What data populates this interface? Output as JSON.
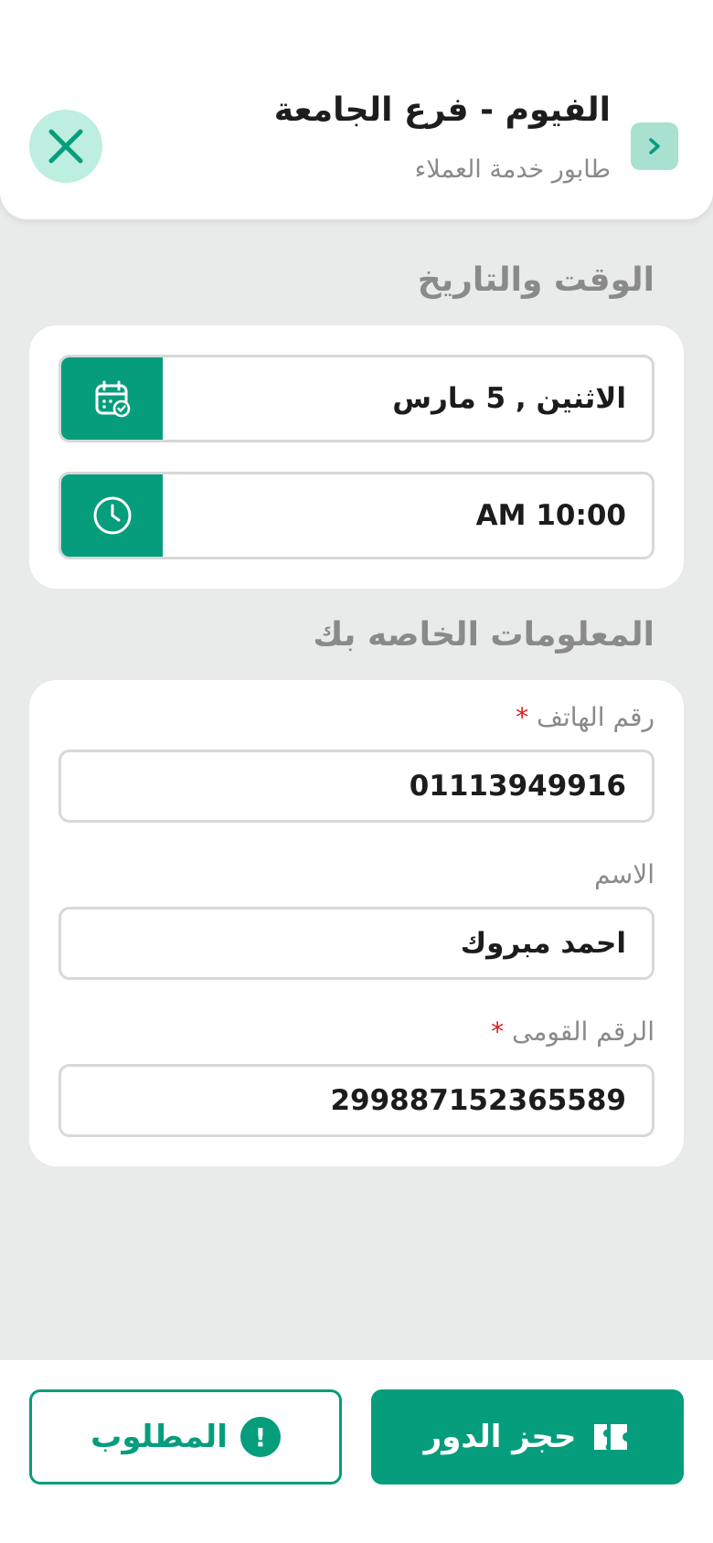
{
  "header": {
    "title": "الفيوم - فرع الجامعة",
    "subtitle": "طابور خدمة العملاء",
    "close_icon": "close-icon",
    "back_icon": "chevron-right-icon"
  },
  "datetime_section": {
    "title": "الوقت والتاريخ",
    "date_value": "الاثنين , 5 مارس",
    "date_icon": "calendar-check-icon",
    "time_value": "10:00 AM",
    "time_icon": "clock-icon"
  },
  "info_section": {
    "title": "المعلومات الخاصه بك",
    "fields": [
      {
        "label": "رقم الهاتف",
        "required_mark": "*",
        "value": "01113949916"
      },
      {
        "label": "الاسم",
        "value": "احمد مبروك"
      },
      {
        "label": "الرقم القومى",
        "required_mark": "*",
        "value": "299887152365589"
      }
    ]
  },
  "actions": {
    "required_label": "المطلوب",
    "required_icon_glyph": "!",
    "book_label": "حجز الدور",
    "book_icon": "ticket-icon"
  },
  "colors": {
    "primary": "#069d7c",
    "close_bg": "#bdeee0",
    "back_bg": "#a9e1d0",
    "required_star": "#e01b1b",
    "background": "#e9ebea"
  }
}
